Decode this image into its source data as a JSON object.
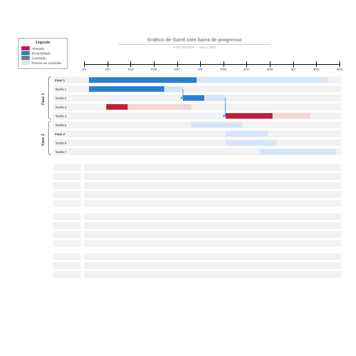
{
  "legend": {
    "title": "Legenda",
    "items": [
      {
        "label": "Atrasado",
        "color": "#c41e3a"
      },
      {
        "label": "Encaminhado",
        "color": "#2a7fd4"
      },
      {
        "label": "Concluído",
        "color": "#7a7a7a"
      },
      {
        "label": "Precisa ser concluído",
        "color": "#d6e6f7"
      }
    ]
  },
  "title": "Gráfico de Gantt com barra de progresso",
  "subtitle": "Gantt Template — April 5, 2022",
  "chart_data": {
    "type": "gantt",
    "x_axis": {
      "ticks": [
        "1/1",
        "1/6",
        "1/13",
        "1/20",
        "1/27",
        "2/3",
        "2/10",
        "2/17",
        "2/24",
        "3/3",
        "3/10",
        "3/16"
      ],
      "domain_start": "1/1",
      "domain_end": "3/16",
      "unit": "date"
    },
    "phases": [
      {
        "name": "Fase 1",
        "rows": [
          {
            "label": "Fase 1",
            "bold": true,
            "start": 1,
            "end": 29,
            "progress": 0.45,
            "status": "ontrack"
          },
          {
            "label": "Tarefa 1",
            "bold": false,
            "start": 1,
            "end": 12,
            "progress": 0.8,
            "status": "ontrack"
          },
          {
            "label": "Tarefa 2",
            "bold": false,
            "start": 12,
            "end": 17,
            "progress": 0.5,
            "status": "ontrack"
          },
          {
            "label": "Tarefa 3",
            "bold": false,
            "start": 3,
            "end": 13,
            "progress": 0.25,
            "status": "late"
          },
          {
            "label": "Tarefa 4",
            "bold": false,
            "start": 17,
            "end": 27,
            "progress": 0.55,
            "status": "late"
          }
        ]
      },
      {
        "name": "Fase 2",
        "rows": [
          {
            "label": "Tarefa 5",
            "bold": false,
            "start": 13,
            "end": 19,
            "progress": 0.0,
            "status": "todo"
          },
          {
            "label": "Fase 2",
            "bold": true,
            "start": 17,
            "end": 22,
            "progress": 0.0,
            "status": "todo"
          },
          {
            "label": "Tarefa 6",
            "bold": false,
            "start": 17,
            "end": 23,
            "progress": 0.0,
            "status": "todo"
          },
          {
            "label": "Tarefa 7",
            "bold": false,
            "start": 21,
            "end": 30,
            "progress": 0.0,
            "status": "todo"
          }
        ]
      }
    ],
    "arrows": [
      {
        "from_row": 1,
        "to_row": 2
      },
      {
        "from_row": 2,
        "to_row": 4
      }
    ],
    "colors": {
      "late_fill": "#c41e3a",
      "late_track": "#f3d6d6",
      "ontrack_fill": "#2a7fd4",
      "ontrack_track": "#d6e6f7",
      "done_fill": "#7a7a7a",
      "todo_track": "#d6e6f7"
    },
    "placeholder_rows": 12
  }
}
